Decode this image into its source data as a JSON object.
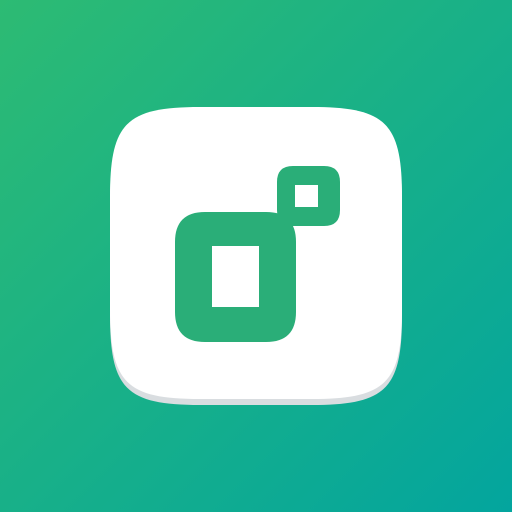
{
  "icon": {
    "name": "app-logo-icon"
  },
  "colors": {
    "gradient_start": "#2dbb73",
    "gradient_end": "#03a59e",
    "tile": "#ffffff",
    "tile_shadow": "#d9dde0",
    "mark": "#2aae78"
  }
}
